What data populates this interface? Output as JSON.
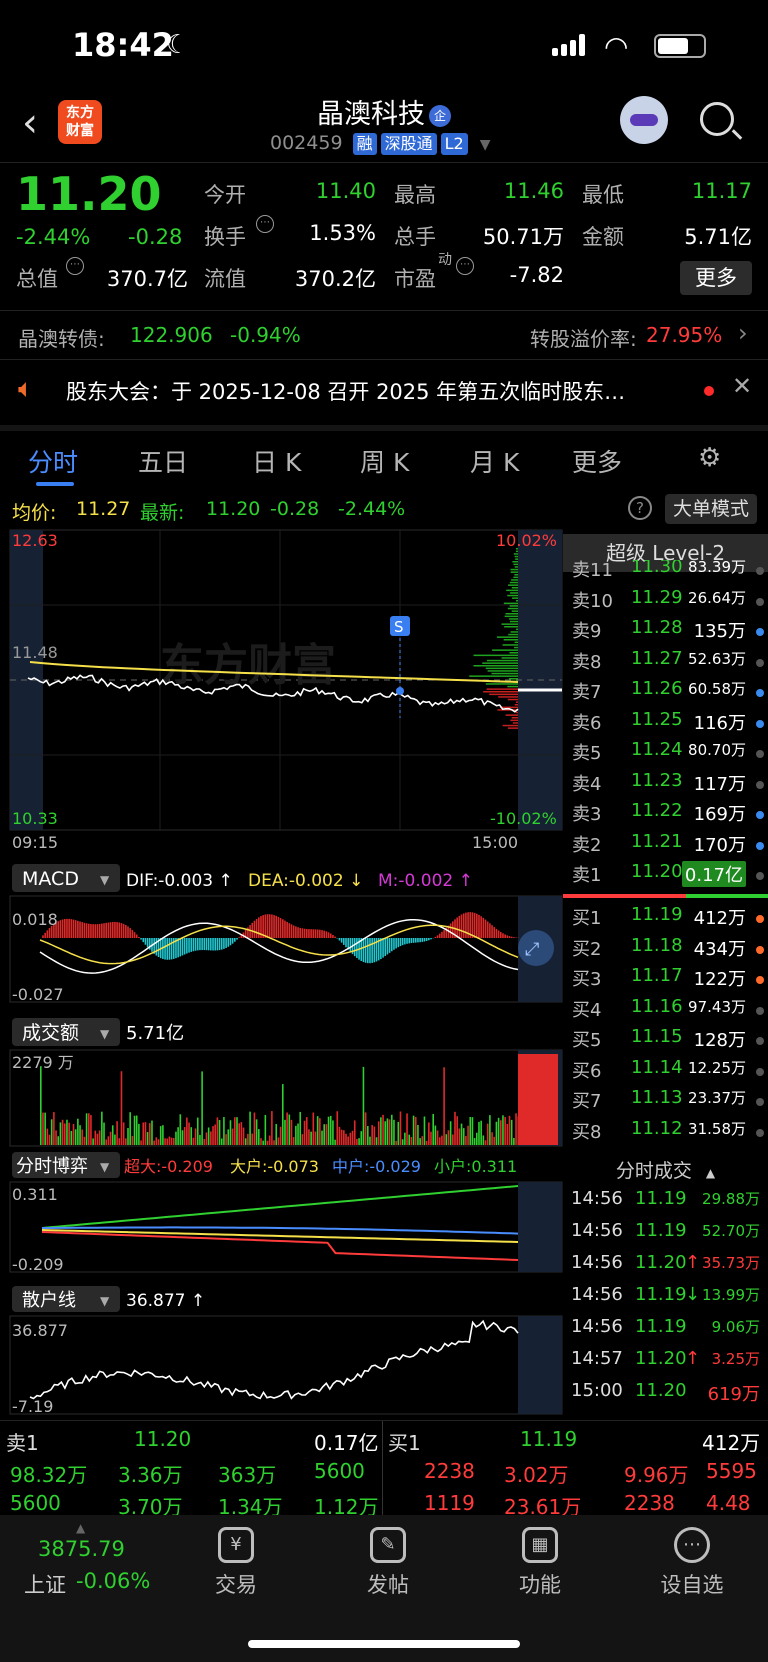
{
  "status": {
    "time": "18:42"
  },
  "header": {
    "logo_text": "东方\n财富",
    "stock_name": "晶澳科技",
    "name_badge": "企",
    "code": "002459",
    "tags": [
      "融",
      "深股通",
      "L2"
    ]
  },
  "quote": {
    "price": "11.20",
    "pct_change": "-2.44%",
    "change": "-0.28",
    "fields": [
      {
        "label": "今开",
        "value": "11.40",
        "color": "#2fd02f"
      },
      {
        "label": "最高",
        "value": "11.46",
        "color": "#2fd02f"
      },
      {
        "label": "最低",
        "value": "11.17",
        "color": "#2fd02f"
      },
      {
        "label": "换手",
        "value": "1.53%",
        "color": "#ffffff"
      },
      {
        "label": "总手",
        "value": "50.71万",
        "color": "#ffffff"
      },
      {
        "label": "金额",
        "value": "5.71亿",
        "color": "#ffffff"
      },
      {
        "label": "总值",
        "value": "370.7亿",
        "color": "#ffffff"
      },
      {
        "label": "流值",
        "value": "370.2亿",
        "color": "#ffffff"
      },
      {
        "label": "市盈",
        "value": "-7.82",
        "color": "#ffffff"
      }
    ],
    "pe_superscript": "动",
    "more_label": "更多"
  },
  "bond": {
    "name": "晶澳转债:",
    "price": "122.906",
    "pct": "-0.94%",
    "premium_label": "转股溢价率:",
    "premium": "27.95%"
  },
  "notice": {
    "text": "股东大会：于 2025-12-08 召开 2025 年第五次临时股东…"
  },
  "tabs": [
    "分时",
    "五日",
    "日 K",
    "周 K",
    "月 K",
    "更多"
  ],
  "avg_row": {
    "avg_label": "均价:",
    "avg": "11.27",
    "latest_label": "最新:",
    "latest": "11.20",
    "chg": "-0.28",
    "pct": "-2.44%",
    "big_mode": "大单模式"
  },
  "price_chart": {
    "y_top": "12.63",
    "y_mid": "11.48",
    "y_bottom": "10.33",
    "pct_top": "10.02%",
    "pct_bottom": "-10.02%",
    "t_start": "09:15",
    "t_end": "15:00",
    "marker": "S",
    "watermark": "东方财富"
  },
  "macd": {
    "title": "MACD",
    "dif": "DIF:-0.003 ↑",
    "dea": "DEA:-0.002 ↓",
    "m": "M:-0.002 ↑",
    "y_top": "0.018",
    "y_bottom": "-0.027"
  },
  "volume": {
    "title": "成交额",
    "total": "5.71亿",
    "y_top": "2279 万"
  },
  "game": {
    "title": "分时博弈",
    "super": "超大:-0.209",
    "large": "大户:-0.073",
    "mid": "中户:-0.029",
    "small": "小户:0.311",
    "y_top": "0.311",
    "y_bottom": "-0.209"
  },
  "retail": {
    "title": "散户线",
    "value": "36.877 ↑",
    "y_top": "36.877",
    "y_bottom": "-7.19"
  },
  "order_book": {
    "title": "超级 Level-2",
    "asks": [
      {
        "label": "卖11",
        "price": "11.30",
        "vol": "83.39万",
        "dot": "#555555"
      },
      {
        "label": "卖10",
        "price": "11.29",
        "vol": "26.64万",
        "dot": "#555555"
      },
      {
        "label": "卖9",
        "price": "11.28",
        "vol": "135万",
        "dot": "#3a8bf0"
      },
      {
        "label": "卖8",
        "price": "11.27",
        "vol": "52.63万",
        "dot": "#555555"
      },
      {
        "label": "卖7",
        "price": "11.26",
        "vol": "60.58万",
        "dot": "#3a8bf0"
      },
      {
        "label": "卖6",
        "price": "11.25",
        "vol": "116万",
        "dot": "#3a8bf0"
      },
      {
        "label": "卖5",
        "price": "11.24",
        "vol": "80.70万",
        "dot": "#555555"
      },
      {
        "label": "卖4",
        "price": "11.23",
        "vol": "117万",
        "dot": "#555555"
      },
      {
        "label": "卖3",
        "price": "11.22",
        "vol": "169万",
        "dot": "#3a8bf0"
      },
      {
        "label": "卖2",
        "price": "11.21",
        "vol": "170万",
        "dot": "#3a8bf0"
      },
      {
        "label": "卖1",
        "price": "11.20",
        "vol": "0.17亿",
        "dot": "#555555"
      }
    ],
    "bids": [
      {
        "label": "买1",
        "price": "11.19",
        "vol": "412万",
        "dot": "#ff6a2b"
      },
      {
        "label": "买2",
        "price": "11.18",
        "vol": "434万",
        "dot": "#ff6a2b"
      },
      {
        "label": "买3",
        "price": "11.17",
        "vol": "122万",
        "dot": "#ff6a2b"
      },
      {
        "label": "买4",
        "price": "11.16",
        "vol": "97.43万",
        "dot": "#555555"
      },
      {
        "label": "买5",
        "price": "11.15",
        "vol": "128万",
        "dot": "#555555"
      },
      {
        "label": "买6",
        "price": "11.14",
        "vol": "12.25万",
        "dot": "#555555"
      },
      {
        "label": "买7",
        "price": "11.13",
        "vol": "23.37万",
        "dot": "#555555"
      },
      {
        "label": "买8",
        "price": "11.12",
        "vol": "31.58万",
        "dot": "#555555"
      }
    ]
  },
  "trades": {
    "title": "分时成交",
    "rows": [
      {
        "time": "14:56",
        "price": "11.19",
        "arrow": "",
        "vol": "29.88万",
        "vcolor": "#2fd02f"
      },
      {
        "time": "14:56",
        "price": "11.19",
        "arrow": "",
        "vol": "52.70万",
        "vcolor": "#2fd02f"
      },
      {
        "time": "14:56",
        "price": "11.20",
        "arrow": "↑",
        "vol": "35.73万",
        "vcolor": "#ff3b3b"
      },
      {
        "time": "14:56",
        "price": "11.19",
        "arrow": "↓",
        "vol": "13.99万",
        "vcolor": "#2fd02f"
      },
      {
        "time": "14:56",
        "price": "11.19",
        "arrow": "",
        "vol": "9.06万",
        "vcolor": "#2fd02f"
      },
      {
        "time": "14:57",
        "price": "11.20",
        "arrow": "↑",
        "vol": "3.25万",
        "vcolor": "#ff3b3b"
      },
      {
        "time": "15:00",
        "price": "11.20",
        "arrow": "",
        "vol": "619万",
        "vcolor": "#ff3b3b"
      }
    ]
  },
  "summary": {
    "ask_label": "卖1",
    "ask_price": "11.20",
    "ask_vol": "0.17亿",
    "bid_label": "买1",
    "bid_price": "11.19",
    "bid_vol": "412万",
    "ask_queue": [
      [
        "98.32万",
        "3.36万",
        "363万",
        "5600"
      ],
      [
        "5600",
        "3.70万",
        "1.34万",
        "1.12万"
      ]
    ],
    "bid_queue": [
      [
        "2238",
        "3.02万",
        "9.96万",
        "5595"
      ],
      [
        "1119",
        "23.61万",
        "2238",
        "4.48万"
      ]
    ]
  },
  "tabbar": {
    "index_value": "3875.79",
    "index_name": "上证",
    "index_pct": "-0.06%",
    "items": [
      "交易",
      "发帖",
      "功能",
      "设自选"
    ]
  }
}
